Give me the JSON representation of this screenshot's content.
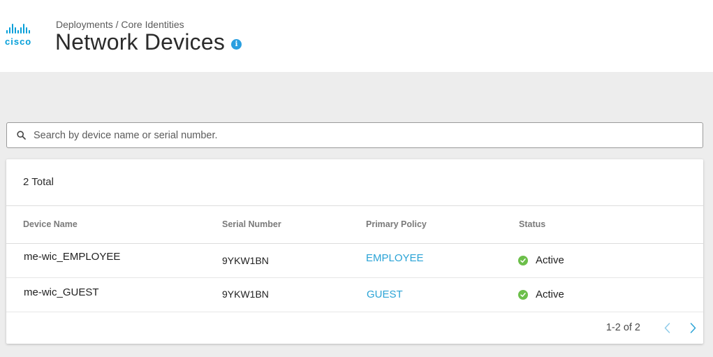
{
  "header": {
    "logo_text": "cisco",
    "breadcrumb": "Deployments / Core Identities",
    "title": "Network Devices",
    "info_icon": "i"
  },
  "search": {
    "placeholder": "Search by device name or serial number.",
    "value": ""
  },
  "table": {
    "total_label": "2 Total",
    "columns": [
      "Device Name",
      "Serial Number",
      "Primary Policy",
      "Status"
    ],
    "rows": [
      {
        "device_name": "me-wic_EMPLOYEE",
        "serial_number": "9YKW1BN",
        "primary_policy": "EMPLOYEE",
        "status": "Active"
      },
      {
        "device_name": "me-wic_GUEST",
        "serial_number": "9YKW1BN",
        "primary_policy": "GUEST",
        "status": "Active"
      }
    ]
  },
  "pagination": {
    "range_label": "1-2 of 2"
  },
  "colors": {
    "brand": "#049fd9",
    "link": "#2aa3d6",
    "status_active": "#6cbf4a",
    "info": "#2a9fe0"
  },
  "icons": {
    "logo": "cisco-logo-icon",
    "info": "info-icon",
    "search": "search-icon",
    "status": "check-circle-icon",
    "prev": "chevron-left-icon",
    "next": "chevron-right-icon"
  }
}
